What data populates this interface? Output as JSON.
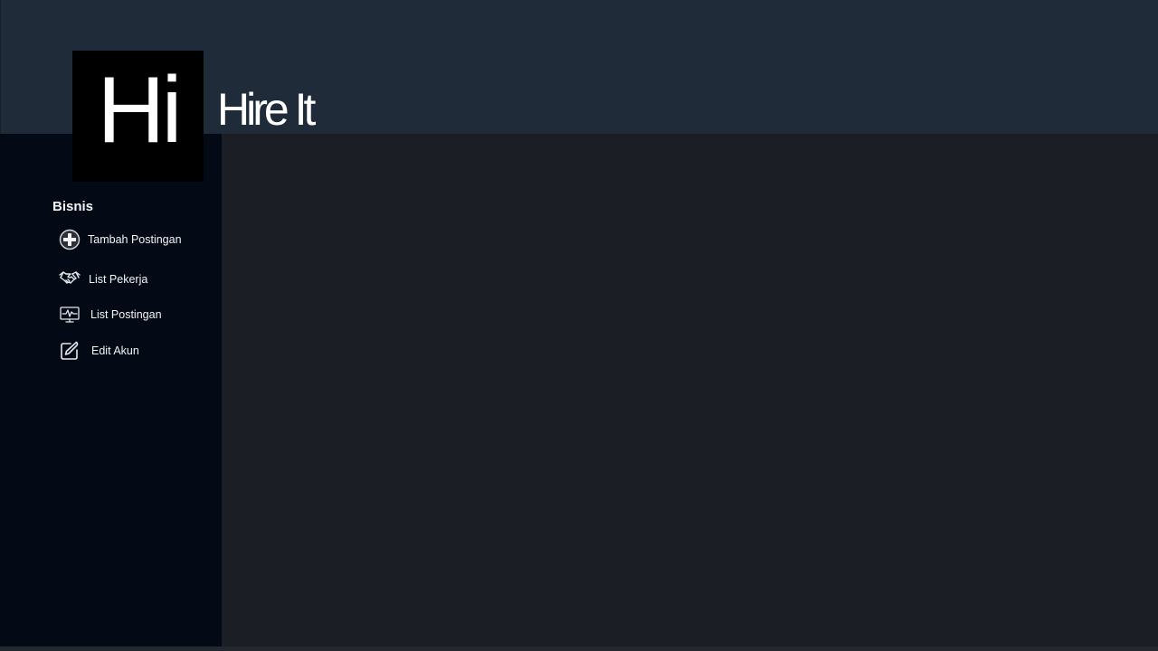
{
  "logo": {
    "text": "Hi"
  },
  "app_title": "Hire It",
  "sidebar": {
    "section_title": "Bisnis",
    "items": [
      {
        "label": "Tambah Postingan",
        "icon": "plus-circle-icon"
      },
      {
        "label": "List Pekerja",
        "icon": "handshake-icon"
      },
      {
        "label": "List Postingan",
        "icon": "monitor-activity-icon"
      },
      {
        "label": "Edit Akun",
        "icon": "edit-icon"
      }
    ]
  },
  "colors": {
    "header_bg": "#1f2b38",
    "sidebar_bg": "#040a15",
    "main_bg": "#1b1f25",
    "logo_bg": "#000000",
    "text": "#ffffff"
  }
}
